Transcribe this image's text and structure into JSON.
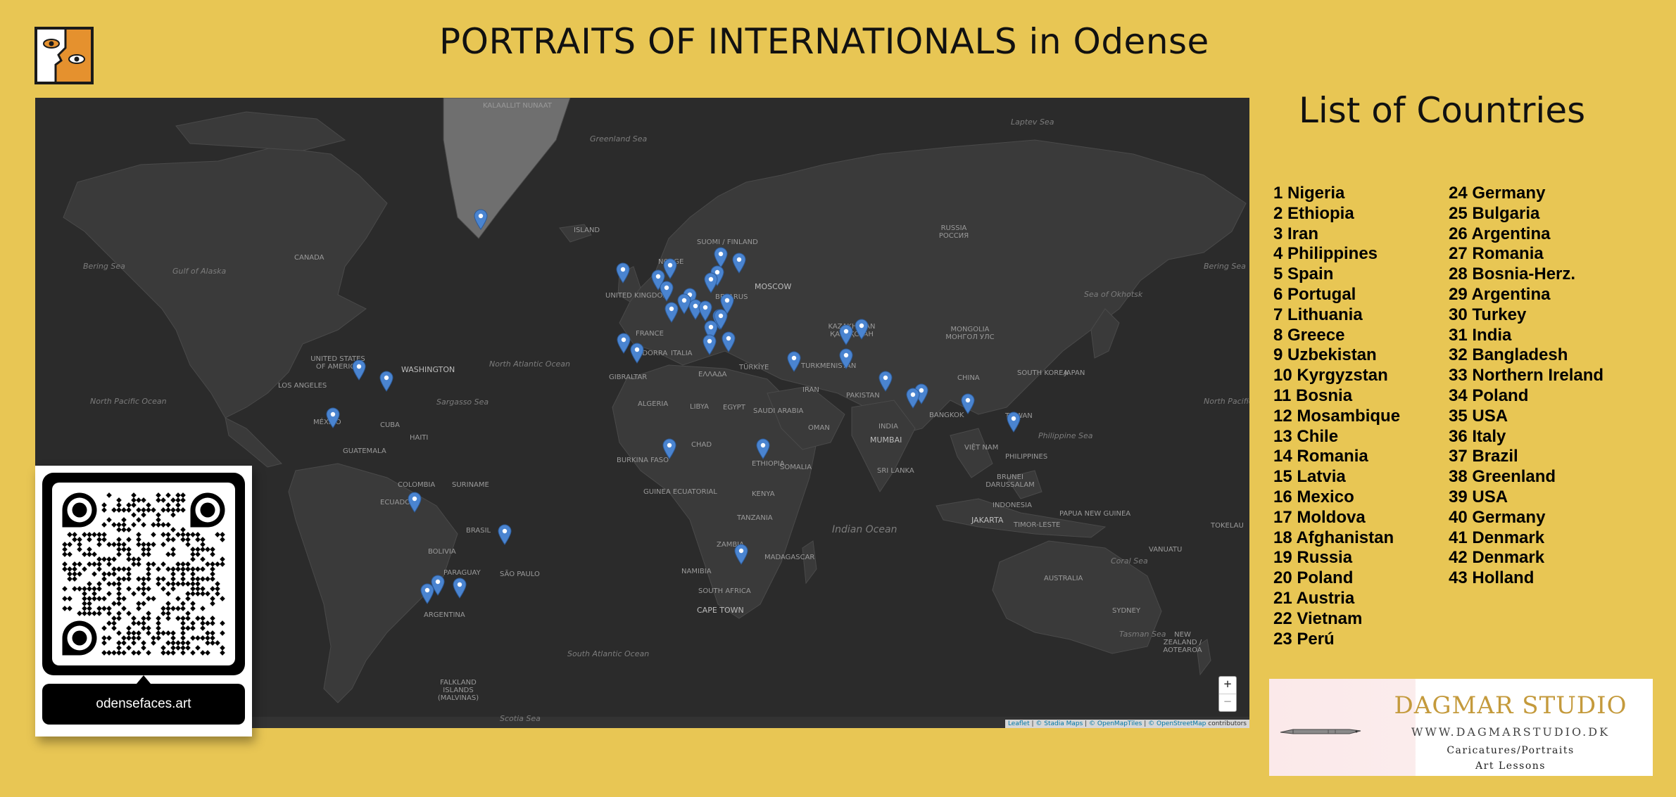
{
  "header": {
    "title": "PORTRAITS OF INTERNATIONALS in Odense"
  },
  "logo": {
    "icon": "face-eyes-logo-icon",
    "colors": {
      "orange": "#e5912e",
      "dark": "#1a1a1a"
    }
  },
  "map": {
    "background": "#2b2b2b",
    "land": "#3a3a3a",
    "marker_color": "#4a84d0",
    "zoom_in": "+",
    "zoom_out": "−",
    "attribution": {
      "leaflet": "Leaflet",
      "stadia": "© Stadia Maps",
      "omt": "© OpenMapTiles",
      "osm": "© OpenStreetMap",
      "contributors": "contributors"
    },
    "labels": {
      "canada": "CANADA",
      "usa": "UNITED STATES OF AMERICA",
      "washington": "WASHINGTON",
      "los_angeles": "LOS ANGELES",
      "mexico": "MÉXICO",
      "cuba": "CUBA",
      "haiti": "HAITI",
      "guatemala": "GUATEMALA",
      "colombia": "COLOMBIA",
      "suriname": "SURINAME",
      "ecuador": "ECUADOR",
      "brasil": "BRASIL",
      "bolivia": "BOLIVIA",
      "paraguay": "PARAGUAY",
      "sao_paulo": "SÃO PAULO",
      "argentina": "ARGENTINA",
      "falkland": "FALKLAND ISLANDS (MALVINAS)",
      "island": "ISLAND",
      "norge": "NORGE",
      "suomi": "SUOMI / FINLAND",
      "uk": "UNITED KINGDOM",
      "belarus": "BELARUS",
      "moscow": "MOSCOW",
      "france": "FRANCE",
      "andorra": "ANDORRA",
      "italia": "ITALIA",
      "gibraltar": "GIBRALTAR",
      "ellada": "ΕΛΛΑΔΑ",
      "turkiye": "TÜRKİYE",
      "algeria": "ALGERIA",
      "libya": "LIBYA",
      "egypt": "EGYPT",
      "saudi": "SAUDI ARABIA",
      "iran": "IRAN",
      "chad": "CHAD",
      "oman": "OMAN",
      "burkina": "BURKINA FASO",
      "somalia": "SOMALIA",
      "ethiopia": "ETHIOPIA",
      "kenya": "KENYA",
      "guinea": "GUINEA ECUATORIAL",
      "tanzania": "TANZANIA",
      "zambia": "ZAMBIA",
      "namibia": "NAMIBIA",
      "madagascar": "MADAGASCAR",
      "south_africa": "SOUTH AFRICA",
      "cape_town": "CAPE TOWN",
      "russia": "RUSSIA РОССИЯ",
      "kazakhstan": "KAZAKHSTAN ҚАЗАҚСТАН",
      "turkmenistan": "TURKMENISTAN",
      "pakistan": "PAKISTAN",
      "mongolia": "MONGOLIA МОНГОЛ УЛС",
      "china": "CHINA",
      "india": "INDIA",
      "mumbai": "MUMBAI",
      "sri_lanka": "SRI LANKA",
      "bangkok": "BANGKOK",
      "viet_nam": "VIỆT NAM",
      "south_korea": "SOUTH KOREA",
      "japan": "JAPAN",
      "taiwan": "TAIWAN",
      "philippines": "PHILIPPINES",
      "brunei": "BRUNEI DARUSSALAM",
      "indonesia": "INDONESIA",
      "jakarta": "JAKARTA",
      "timor": "TIMOR-LESTE",
      "papua": "PAPUA NEW GUINEA",
      "australia": "AUSTRALIA",
      "sydney": "SYDNEY",
      "new_zealand": "NEW ZEALAND / AOTEAROA",
      "vanuatu": "VANUATU",
      "tokelau": "TOKELAU",
      "beringsea": "Bering Sea",
      "gulf_alaska": "Gulf of Alaska",
      "north_pacific": "North Pacific Ocean",
      "north_atlantic": "North Atlantic Ocean",
      "sargasso": "Sargasso Sea",
      "south_atlantic": "South Atlantic Ocean",
      "indian_ocean": "Indian Ocean",
      "greenland_sea": "Greenland Sea",
      "laptev": "Laptev Sea",
      "okhotsk": "Sea of Okhotsk",
      "philippine_sea": "Philippine Sea",
      "coral_sea": "Coral Sea",
      "tasman": "Tasman Sea",
      "scotia": "Scotia Sea",
      "beringsea2": "Bering Sea",
      "north_pacific2": "North Pacific Ocean",
      "kalaallit": "KALAALLIT NUNAAT"
    }
  },
  "qr": {
    "icon": "qr-code-icon",
    "caption": "odensefaces.art"
  },
  "countries": {
    "title": "List of Countries",
    "col1": [
      "1 Nigeria",
      "2 Ethiopia",
      "3 Iran",
      "4 Philippines",
      "5 Spain",
      "6 Portugal",
      "7 Lithuania",
      "8 Greece",
      "9 Uzbekistan",
      "10 Kyrgyzstan",
      "11 Bosnia",
      "12 Mosambique",
      "13 Chile",
      "14 Romania",
      "15 Latvia",
      "16 Mexico",
      "17 Moldova",
      "18 Afghanistan",
      "19 Russia",
      "20 Poland",
      "21 Austria",
      "22 Vietnam",
      "23 Perú"
    ],
    "col2": [
      "24 Germany",
      "25 Bulgaria",
      "26 Argentina",
      "27 Romania",
      "28 Bosnia-Herz.",
      "29 Argentina",
      "30 Turkey",
      "31 India",
      "32 Bangladesh",
      "33 Northern Ireland",
      "34 Poland",
      "35 USA",
      "36 Italy",
      "37 Brazil",
      "38 Greenland",
      "39 USA",
      "40 Germany",
      "41 Denmark",
      "42 Denmark",
      "43 Holland"
    ]
  },
  "studio": {
    "name": "DAGMAR STUDIO",
    "website": "WWW.DAGMARSTUDIO.DK",
    "line1": "Caricatures/Portraits",
    "line2": "Art Lessons",
    "icon": "fountain-pen-icon",
    "gold": "#c49a3c"
  }
}
